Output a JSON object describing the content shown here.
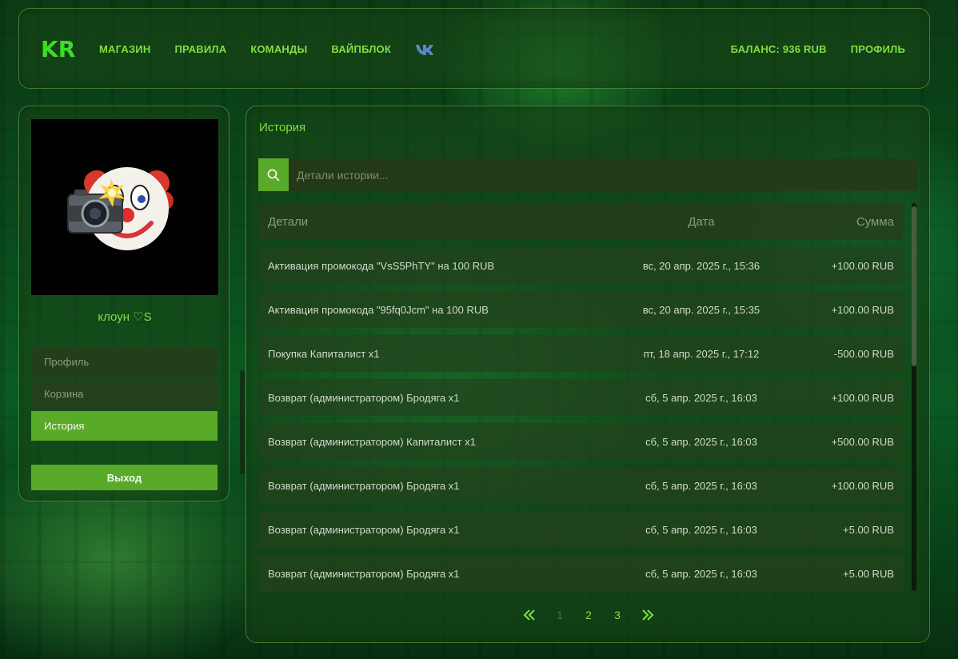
{
  "colors": {
    "accent": "#7fe040",
    "button": "#5aaa2a"
  },
  "header": {
    "logo_text": "KR",
    "nav": [
      "МАГАЗИН",
      "ПРАВИЛА",
      "КОМАНДЫ",
      "ВАЙПБЛОК"
    ],
    "social_icon": "vk-icon",
    "balance": "БАЛАНС: 936 RUB",
    "profile": "ПРОФИЛЬ"
  },
  "sidebar": {
    "avatar_icon": "clown-camera-icon",
    "username": "клоун ♡S",
    "menu": [
      {
        "label": "Профиль",
        "active": false
      },
      {
        "label": "Корзина",
        "active": false
      },
      {
        "label": "История",
        "active": true
      }
    ],
    "logout": "Выход"
  },
  "main": {
    "title": "История",
    "search": {
      "placeholder": "Детали истории...",
      "value": ""
    },
    "columns": {
      "details": "Детали",
      "date": "Дата",
      "amount": "Сумма"
    },
    "rows": [
      {
        "details": "Активация промокода \"VsS5PhTY\" на 100 RUB",
        "date": "вс, 20 апр. 2025 г., 15:36",
        "amount": "+100.00 RUB"
      },
      {
        "details": "Активация промокода \"95fq0Jcm\" на 100 RUB",
        "date": "вс, 20 апр. 2025 г., 15:35",
        "amount": "+100.00 RUB"
      },
      {
        "details": "Покупка Капиталист x1",
        "date": "пт, 18 апр. 2025 г., 17:12",
        "amount": "-500.00 RUB"
      },
      {
        "details": "Возврат (администратором) Бродяга x1",
        "date": "сб, 5 апр. 2025 г., 16:03",
        "amount": "+100.00 RUB"
      },
      {
        "details": "Возврат (администратором) Капиталист x1",
        "date": "сб, 5 апр. 2025 г., 16:03",
        "amount": "+500.00 RUB"
      },
      {
        "details": "Возврат (администратором) Бродяга x1",
        "date": "сб, 5 апр. 2025 г., 16:03",
        "amount": "+100.00 RUB"
      },
      {
        "details": "Возврат (администратором) Бродяга x1",
        "date": "сб, 5 апр. 2025 г., 16:03",
        "amount": "+5.00 RUB"
      },
      {
        "details": "Возврат (администратором) Бродяга x1",
        "date": "сб, 5 апр. 2025 г., 16:03",
        "amount": "+5.00 RUB"
      }
    ],
    "pagination": {
      "pages": [
        "1",
        "2",
        "3"
      ],
      "current": "1",
      "prev_icon": "double-chevron-left-icon",
      "next_icon": "double-chevron-right-icon"
    }
  }
}
